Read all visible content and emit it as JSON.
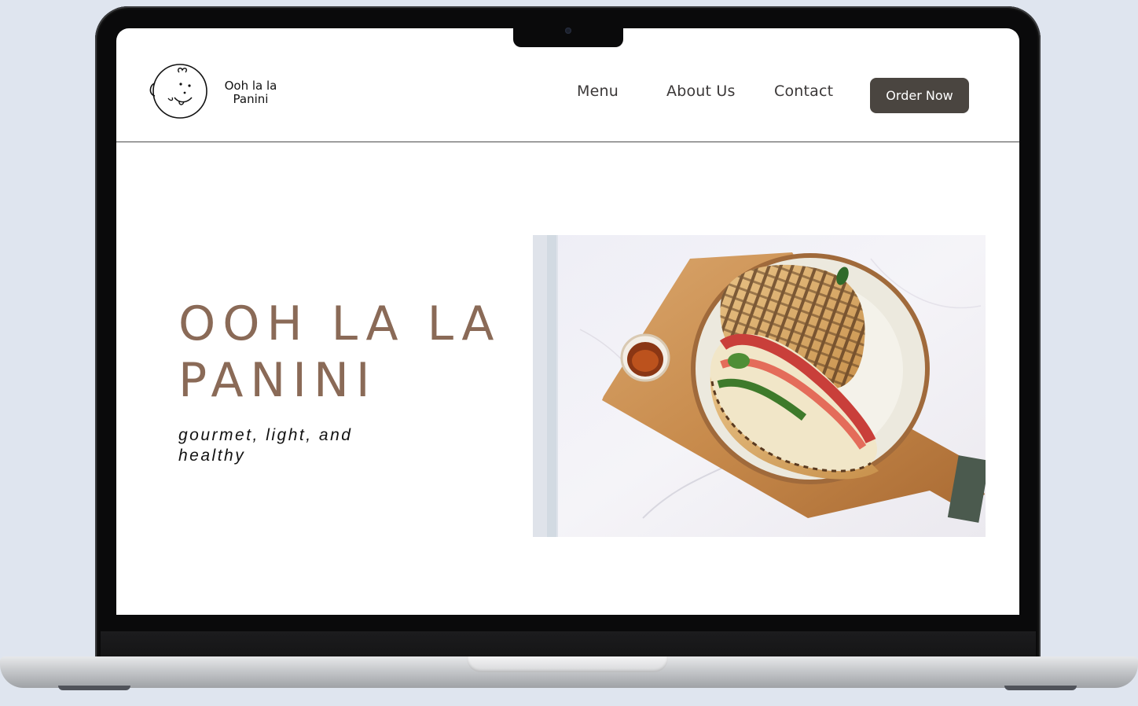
{
  "site": {
    "logo": {
      "line1": "Ooh la la",
      "line2": "Panini",
      "icon": "smiling-face-icon"
    },
    "nav": {
      "menu": "Menu",
      "about": "About Us",
      "contact": "Contact",
      "order": "Order Now"
    },
    "hero": {
      "title_line1": "OOH LA LA",
      "title_line2": "PANINI",
      "subtitle": "gourmet, light, and healthy",
      "image": "panini-sandwich-on-plate-photo"
    }
  },
  "colors": {
    "accent": "#8a6a57",
    "button": "#4a4540",
    "nav_text": "#3b3838",
    "page_background": "#dfe5ef"
  }
}
